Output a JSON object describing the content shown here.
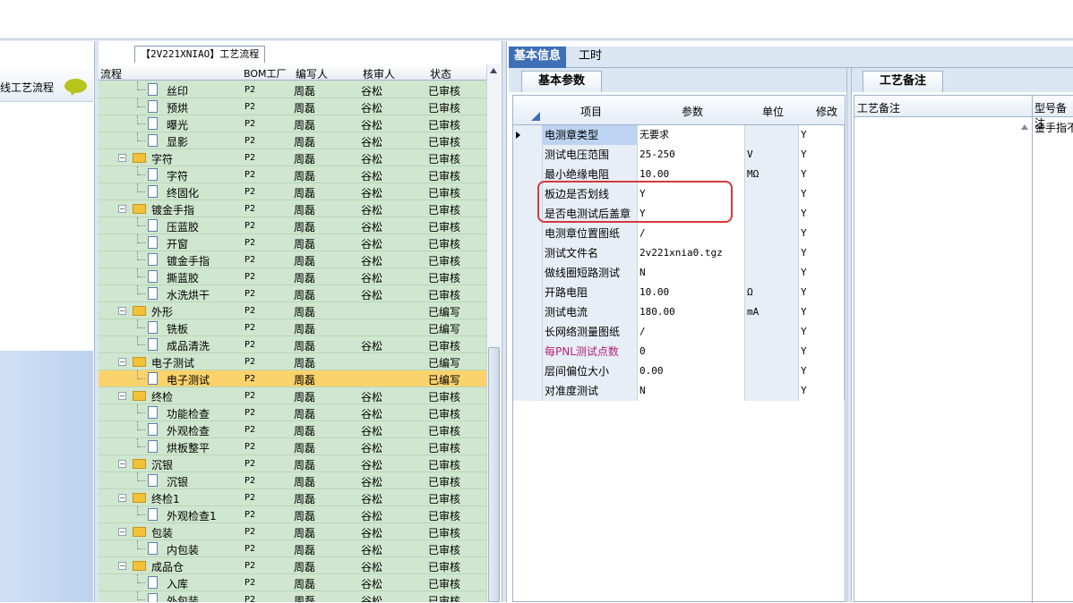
{
  "left_panel": {
    "title": "线工艺流程",
    "chat_icon": "speech-bubble-icon"
  },
  "tree": {
    "title": "【2V221XNIAO】工艺流程",
    "columns": [
      "流程",
      "BOM工厂",
      "编写人",
      "核审人",
      "状态"
    ],
    "rows": [
      {
        "name": "丝印",
        "level": 2,
        "type": "file",
        "bom": "P2",
        "writer": "周磊",
        "reviewer": "谷松",
        "status": "已审核"
      },
      {
        "name": "预烘",
        "level": 2,
        "type": "file",
        "bom": "P2",
        "writer": "周磊",
        "reviewer": "谷松",
        "status": "已审核"
      },
      {
        "name": "曝光",
        "level": 2,
        "type": "file",
        "bom": "P2",
        "writer": "周磊",
        "reviewer": "谷松",
        "status": "已审核"
      },
      {
        "name": "显影",
        "level": 2,
        "type": "file",
        "bom": "P2",
        "writer": "周磊",
        "reviewer": "谷松",
        "status": "已审核"
      },
      {
        "name": "字符",
        "level": 1,
        "type": "folder",
        "bom": "P2",
        "writer": "周磊",
        "reviewer": "谷松",
        "status": "已审核"
      },
      {
        "name": "字符",
        "level": 2,
        "type": "file",
        "bom": "P2",
        "writer": "周磊",
        "reviewer": "谷松",
        "status": "已审核"
      },
      {
        "name": "终固化",
        "level": 2,
        "type": "file",
        "bom": "P2",
        "writer": "周磊",
        "reviewer": "谷松",
        "status": "已审核"
      },
      {
        "name": "镀金手指",
        "level": 1,
        "type": "folder",
        "bom": "P2",
        "writer": "周磊",
        "reviewer": "谷松",
        "status": "已审核"
      },
      {
        "name": "压蓝胶",
        "level": 2,
        "type": "file",
        "bom": "P2",
        "writer": "周磊",
        "reviewer": "谷松",
        "status": "已审核"
      },
      {
        "name": "开窗",
        "level": 2,
        "type": "file",
        "bom": "P2",
        "writer": "周磊",
        "reviewer": "谷松",
        "status": "已审核"
      },
      {
        "name": "镀金手指",
        "level": 2,
        "type": "file",
        "bom": "P2",
        "writer": "周磊",
        "reviewer": "谷松",
        "status": "已审核"
      },
      {
        "name": "撕蓝胶",
        "level": 2,
        "type": "file",
        "bom": "P2",
        "writer": "周磊",
        "reviewer": "谷松",
        "status": "已审核"
      },
      {
        "name": "水洗烘干",
        "level": 2,
        "type": "file",
        "bom": "P2",
        "writer": "周磊",
        "reviewer": "谷松",
        "status": "已审核"
      },
      {
        "name": "外形",
        "level": 1,
        "type": "folder",
        "bom": "P2",
        "writer": "周磊",
        "reviewer": "",
        "status": "已编写"
      },
      {
        "name": "铣板",
        "level": 2,
        "type": "file",
        "bom": "P2",
        "writer": "周磊",
        "reviewer": "",
        "status": "已编写"
      },
      {
        "name": "成品清洗",
        "level": 2,
        "type": "file",
        "bom": "P2",
        "writer": "周磊",
        "reviewer": "谷松",
        "status": "已审核"
      },
      {
        "name": "电子测试",
        "level": 1,
        "type": "folder",
        "bom": "P2",
        "writer": "周磊",
        "reviewer": "",
        "status": "已编写"
      },
      {
        "name": "电子测试",
        "level": 2,
        "type": "file",
        "bom": "P2",
        "writer": "周磊",
        "reviewer": "",
        "status": "已编写",
        "selected": true
      },
      {
        "name": "终检",
        "level": 1,
        "type": "folder",
        "bom": "P2",
        "writer": "周磊",
        "reviewer": "谷松",
        "status": "已审核"
      },
      {
        "name": "功能检查",
        "level": 2,
        "type": "file",
        "bom": "P2",
        "writer": "周磊",
        "reviewer": "谷松",
        "status": "已审核"
      },
      {
        "name": "外观检查",
        "level": 2,
        "type": "file",
        "bom": "P2",
        "writer": "周磊",
        "reviewer": "谷松",
        "status": "已审核"
      },
      {
        "name": "烘板整平",
        "level": 2,
        "type": "file",
        "bom": "P2",
        "writer": "周磊",
        "reviewer": "谷松",
        "status": "已审核"
      },
      {
        "name": "沉银",
        "level": 1,
        "type": "folder",
        "bom": "P2",
        "writer": "周磊",
        "reviewer": "谷松",
        "status": "已审核"
      },
      {
        "name": "沉银",
        "level": 2,
        "type": "file",
        "bom": "P2",
        "writer": "周磊",
        "reviewer": "谷松",
        "status": "已审核"
      },
      {
        "name": "终检1",
        "level": 1,
        "type": "folder",
        "bom": "P2",
        "writer": "周磊",
        "reviewer": "谷松",
        "status": "已审核"
      },
      {
        "name": "外观检查1",
        "level": 2,
        "type": "file",
        "bom": "P2",
        "writer": "周磊",
        "reviewer": "谷松",
        "status": "已审核"
      },
      {
        "name": "包装",
        "level": 1,
        "type": "folder",
        "bom": "P2",
        "writer": "周磊",
        "reviewer": "谷松",
        "status": "已审核"
      },
      {
        "name": "内包装",
        "level": 2,
        "type": "file",
        "bom": "P2",
        "writer": "周磊",
        "reviewer": "谷松",
        "status": "已审核"
      },
      {
        "name": "成品仓",
        "level": 1,
        "type": "folder",
        "bom": "P2",
        "writer": "周磊",
        "reviewer": "谷松",
        "status": "已审核"
      },
      {
        "name": "入库",
        "level": 2,
        "type": "file",
        "bom": "P2",
        "writer": "周磊",
        "reviewer": "谷松",
        "status": "已审核"
      },
      {
        "name": "外包装",
        "level": 2,
        "type": "file",
        "bom": "P2",
        "writer": "周磊",
        "reviewer": "谷松",
        "status": "已审核"
      }
    ]
  },
  "tabs": [
    "基本信息",
    "工时"
  ],
  "params": {
    "tab_label": "基本参数",
    "columns": [
      "项目",
      "参数",
      "单位",
      "修改"
    ],
    "rows": [
      {
        "item": "电测章类型",
        "value": "无要求",
        "unit": "",
        "modify": "Y",
        "current": true
      },
      {
        "item": "测试电压范围",
        "value": "25-250",
        "unit": "V",
        "modify": "Y"
      },
      {
        "item": "最小绝缘电阻",
        "value": "10.00",
        "unit": "MΩ",
        "modify": "Y"
      },
      {
        "item": "板边是否划线",
        "value": "Y",
        "unit": "",
        "modify": "Y"
      },
      {
        "item": "是否电测试后盖章",
        "value": "Y",
        "unit": "",
        "modify": "Y"
      },
      {
        "item": "电测章位置图纸",
        "value": "/",
        "unit": "",
        "modify": "Y"
      },
      {
        "item": "测试文件名",
        "value": "2v221xnia0.tgz",
        "unit": "",
        "modify": "Y"
      },
      {
        "item": "做线圈短路测试",
        "value": "N",
        "unit": "",
        "modify": "Y"
      },
      {
        "item": "开路电阻",
        "value": "10.00",
        "unit": "Ω",
        "modify": "Y"
      },
      {
        "item": "测试电流",
        "value": "180.00",
        "unit": "mA",
        "modify": "Y"
      },
      {
        "item": "长网络测量图纸",
        "value": "/",
        "unit": "",
        "modify": "Y"
      },
      {
        "item": "每PNL测试点数",
        "value": "0",
        "unit": "",
        "modify": "Y",
        "highlight_color": "#b0237a"
      },
      {
        "item": "层间偏位大小",
        "value": "0.00",
        "unit": "",
        "modify": "Y"
      },
      {
        "item": "对准度测试",
        "value": "N",
        "unit": "",
        "modify": "Y"
      }
    ]
  },
  "notes": {
    "tab_label": "工艺备注",
    "columns": [
      "工艺备注",
      "型号备注"
    ],
    "model_note_value": "金手指不"
  }
}
